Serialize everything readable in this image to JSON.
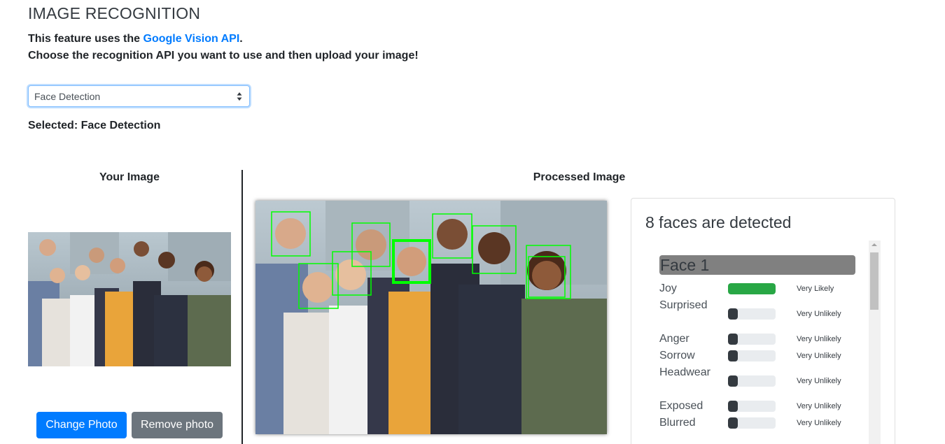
{
  "header": {
    "title": "IMAGE RECOGNITION",
    "intro_prefix": "This feature uses the ",
    "api_link": "Google Vision API",
    "intro_suffix": ".",
    "instructions": "Choose the recognition API you want to use and then upload your image!"
  },
  "api_select": {
    "value": "Face Detection",
    "caret_icon": "updown-caret-icon"
  },
  "selected_text": "Selected: Face Detection",
  "left_column": {
    "heading": "Your Image",
    "change_button": "Change Photo",
    "remove_button": "Remove photo"
  },
  "right_column": {
    "heading": "Processed Image"
  },
  "results": {
    "title": "8 faces are detected",
    "face": {
      "name": "Face 1",
      "emotions": [
        {
          "label": "Joy",
          "likelihood": "Very Likely",
          "level": 1.0,
          "color": "#28a745"
        },
        {
          "label": "Surprised",
          "likelihood": "Very Unlikely",
          "level": 0.2,
          "color": "#343a40"
        },
        {
          "label": "Anger",
          "likelihood": "Very Unlikely",
          "level": 0.2,
          "color": "#343a40"
        },
        {
          "label": "Sorrow",
          "likelihood": "Very Unlikely",
          "level": 0.2,
          "color": "#343a40"
        },
        {
          "label": "Headwear",
          "likelihood": "Very Unlikely",
          "level": 0.2,
          "color": "#343a40"
        },
        {
          "label": "Exposed",
          "likelihood": "Very Unlikely",
          "level": 0.2,
          "color": "#343a40"
        },
        {
          "label": "Blurred",
          "likelihood": "Very Unlikely",
          "level": 0.2,
          "color": "#343a40"
        }
      ]
    }
  },
  "colors": {
    "primary": "#007bff",
    "secondary": "#6c757d",
    "detection_box": "#00ff00"
  }
}
